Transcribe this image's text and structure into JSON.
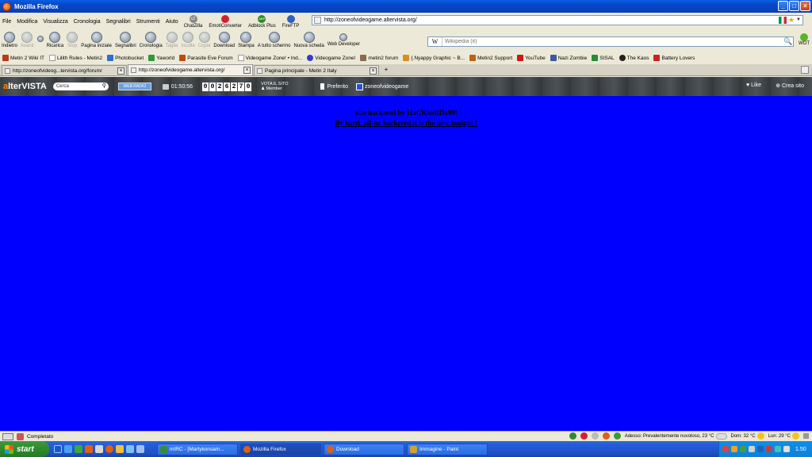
{
  "window": {
    "title": "Mozilla Firefox",
    "buttons": {
      "minimize": "_",
      "maximize": "□",
      "close": "×"
    }
  },
  "menu": {
    "items": [
      "File",
      "Modifica",
      "Visualizza",
      "Cronologia",
      "Segnalibri",
      "Strumenti",
      "Aiuto"
    ],
    "tools": [
      {
        "label": "ChatZilla",
        "top": "cZ",
        "color": "#888888"
      },
      {
        "label": "EmotiConverter",
        "top": "",
        "color": "#d2202f"
      },
      {
        "label": "Adblock Plus",
        "top": "ABP",
        "color": "#2e8b2e"
      },
      {
        "label": "FireFTP",
        "top": "",
        "color": "#3060c0"
      }
    ]
  },
  "address": {
    "url": "http://zoneofvideogame.altervista.org/"
  },
  "nav": {
    "buttons": [
      {
        "label": "Indietro",
        "enabled": true
      },
      {
        "label": "Avanti",
        "enabled": false
      },
      {
        "label": "",
        "enabled": true
      },
      {
        "label": "Ricarica",
        "enabled": true
      },
      {
        "label": "Stop",
        "enabled": false
      },
      {
        "label": "Pagina iniziale",
        "enabled": true
      },
      {
        "label": "Segnalibri",
        "enabled": true
      },
      {
        "label": "Cronologia",
        "enabled": true
      },
      {
        "label": "Taglia",
        "enabled": false
      },
      {
        "label": "Incolla",
        "enabled": false
      },
      {
        "label": "Copia",
        "enabled": false
      },
      {
        "label": "Download",
        "enabled": true
      },
      {
        "label": "Stampa",
        "enabled": true
      },
      {
        "label": "A tutto schermo",
        "enabled": true
      },
      {
        "label": "Nuova scheda",
        "enabled": true
      },
      {
        "label": "Web Developer",
        "enabled": true
      }
    ],
    "search": {
      "engine": "W",
      "placeholder": "Wikipedia (it)"
    },
    "wot": "WOT"
  },
  "bookmarks": [
    {
      "label": "Metin 2 Wiki IT",
      "color": "#b33a1a"
    },
    {
      "label": "Lilith Rules - Metin2",
      "color": "#ffffff"
    },
    {
      "label": "Photobucket",
      "color": "#2c6fd1"
    },
    {
      "label": "Yaworld",
      "color": "#2a9a3a"
    },
    {
      "label": "Parasite Eve Forum",
      "color": "#c04a10"
    },
    {
      "label": "Videogame Zone! • Ind...",
      "color": "#ffffff"
    },
    {
      "label": "Videogame Zone!",
      "color": "#3a38c8"
    },
    {
      "label": "metin2 forum",
      "color": "#8a6a4a"
    },
    {
      "label": "{.Nyappy Graphic ~ B...",
      "color": "#d89020"
    },
    {
      "label": "Metin2 Support",
      "color": "#c06010"
    },
    {
      "label": "YouTube",
      "color": "#cc1818"
    },
    {
      "label": "Nazi Zombie",
      "color": "#3a5a9a"
    },
    {
      "label": "SISAL",
      "color": "#2a8a3a"
    },
    {
      "label": "The Kaos",
      "color": "#222222"
    },
    {
      "label": "Battery Lovers",
      "color": "#d02020"
    }
  ],
  "tabs": [
    {
      "label": "http://zoneofvideog...tervista.org/forum/",
      "active": false
    },
    {
      "label": "http://zoneofvideogame.altervista.org/",
      "active": true
    },
    {
      "label": "Pagina principale - Metin 2 Italy",
      "active": false
    }
  ],
  "altervista": {
    "logo_a": "a",
    "logo_rest": "lterVISTA",
    "search_placeholder": "Cerca",
    "badge": "WEB RADIO",
    "clock": "01:50:56",
    "counter": [
      "0",
      "0",
      "2",
      "6",
      "2",
      "7",
      "0"
    ],
    "vote_line1": "VOTA IL SITO",
    "vote_line2": "♟ Member",
    "preferito": "Preferito",
    "site_name": "zoneofvideogame",
    "like": "Like",
    "create": "Crea sito"
  },
  "content": {
    "title": "Site hackered by HaCKheRDo99!",
    "subtitle": "By hard_aff-uc hackered.it is the dc-c tonight !"
  },
  "status": {
    "text": "Completato",
    "weather": "Adesso: Prevalentemente nuvoloso, 23 °C",
    "dom": "Dom: 32 °C",
    "lun": "Lun: 29 °C"
  },
  "taskbar": {
    "start": "start",
    "tasks": [
      {
        "label": "mIRC - [Martykonsam...",
        "color": "#3a8a3a",
        "active": false
      },
      {
        "label": "Mozilla Firefox",
        "color": "#e06010",
        "active": true
      },
      {
        "label": "Download",
        "color": "#e06010",
        "active": false
      },
      {
        "label": "Immagine - Paint",
        "color": "#d0a030",
        "active": false
      }
    ],
    "clock": "1.50"
  }
}
